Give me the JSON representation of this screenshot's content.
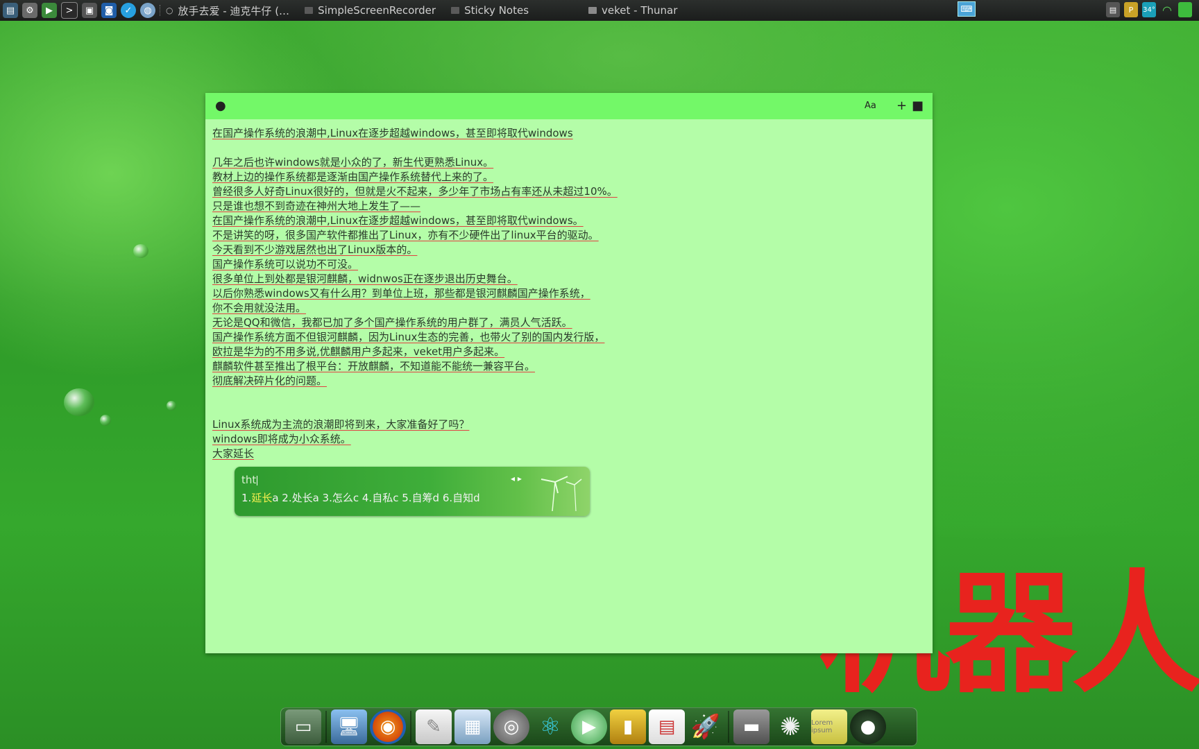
{
  "topbar": {
    "launchers": [
      "system-monitor-icon",
      "settings-icon",
      "media-player-icon",
      "terminal-icon",
      "screenshot-icon",
      "display-icon",
      "clock-icon",
      "browser-icon"
    ],
    "tasks": [
      {
        "label": "放手去爱 - 迪克牛仔 (…",
        "icon": "music-task-icon"
      },
      {
        "label": "SimpleScreenRecorder",
        "icon": "window-task-icon"
      },
      {
        "label": "Sticky Notes",
        "icon": "window-task-icon"
      },
      {
        "label": "veket - Thunar",
        "icon": "folder-task-icon"
      }
    ],
    "tray": {
      "temperature": "34°"
    }
  },
  "note": {
    "lines": [
      "在国产操作系统的浪潮中,Linux在逐步超越windows，甚至即将取代windows",
      "",
      "几年之后也许windows就是小众的了，新生代更熟悉Linux。",
      "教材上边的操作系统都是逐渐由国产操作系统替代上来的了。",
      "曾经很多人好奇Linux很好的，但就是火不起来，多少年了市场占有率还从未超过10%。",
      "只是谁也想不到奇迹在神州大地上发生了——",
      "在国产操作系统的浪潮中,Linux在逐步超越windows，甚至即将取代windows。",
      "不是讲笑的呀，很多国产软件都推出了Linux，亦有不少硬件出了linux平台的驱动。",
      "今天看到不少游戏居然也出了Linux版本的。",
      "国产操作系统可以说功不可没。",
      "很多单位上到处都是银河麒麟，widnwos正在逐步退出历史舞台。",
      "以后你熟悉windows又有什么用？到单位上班，那些都是银河麒麟国产操作系统，",
      "你不会用就没法用。",
      "无论是QQ和微信，我都已加了多个国产操作系统的用户群了，满员人气活跃。",
      "国产操作系统方面不但银河麒麟，因为Linux生态的完善，也带火了别的国内发行版，",
      "欧拉是华为的不用多说,优麒麟用户多起来，veket用户多起来。",
      "麒麟软件甚至推出了根平台：开放麒麟，不知道能不能统一兼容平台。",
      "彻底解决碎片化的问题。",
      "",
      "",
      "Linux系统成为主流的浪潮即将到来，大家准备好了吗？",
      "windows即将成为小众系统。",
      "大家延长"
    ]
  },
  "ime": {
    "preedit": "tht",
    "candidates_prefix": "1.",
    "candidate_selected": "延长",
    "candidates_rest": "a 2.处长a 3.怎么c 4.自私c 5.自筹d 6.自知d",
    "arrows": "◂ ▸"
  },
  "desktop": {
    "watermark_text": "机器人"
  },
  "dock": {
    "items": [
      {
        "name": "desktop-app-icon",
        "glyph": "▭"
      },
      {
        "name": "computer-icon",
        "glyph": "🖥"
      },
      {
        "name": "firefox-icon",
        "glyph": "◉"
      },
      {
        "name": "text-editor-icon",
        "glyph": "✎"
      },
      {
        "name": "image-viewer-icon",
        "glyph": "▦"
      },
      {
        "name": "audio-icon",
        "glyph": "◎"
      },
      {
        "name": "atom-icon",
        "glyph": "⚛"
      },
      {
        "name": "play-icon",
        "glyph": "▶"
      },
      {
        "name": "notebook-icon",
        "glyph": "▮"
      },
      {
        "name": "presentation-icon",
        "glyph": "▤"
      },
      {
        "name": "rocket-icon",
        "glyph": "🚀"
      },
      {
        "name": "drive-icon",
        "glyph": "▬"
      },
      {
        "name": "brightness-icon",
        "glyph": "✺"
      },
      {
        "name": "sticky-notes-icon",
        "glyph": "Lorem ipsum"
      },
      {
        "name": "globe-icon",
        "glyph": "●"
      }
    ]
  }
}
